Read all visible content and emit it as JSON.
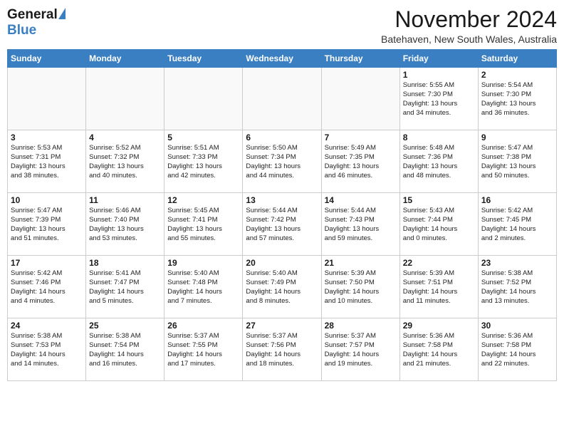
{
  "header": {
    "logo_general": "General",
    "logo_blue": "Blue",
    "month": "November 2024",
    "location": "Batehaven, New South Wales, Australia"
  },
  "weekdays": [
    "Sunday",
    "Monday",
    "Tuesday",
    "Wednesday",
    "Thursday",
    "Friday",
    "Saturday"
  ],
  "weeks": [
    {
      "days": [
        {
          "date": "",
          "info": "",
          "empty": true
        },
        {
          "date": "",
          "info": "",
          "empty": true
        },
        {
          "date": "",
          "info": "",
          "empty": true
        },
        {
          "date": "",
          "info": "",
          "empty": true
        },
        {
          "date": "",
          "info": "",
          "empty": true
        },
        {
          "date": "1",
          "info": "Sunrise: 5:55 AM\nSunset: 7:30 PM\nDaylight: 13 hours\nand 34 minutes."
        },
        {
          "date": "2",
          "info": "Sunrise: 5:54 AM\nSunset: 7:30 PM\nDaylight: 13 hours\nand 36 minutes."
        }
      ]
    },
    {
      "days": [
        {
          "date": "3",
          "info": "Sunrise: 5:53 AM\nSunset: 7:31 PM\nDaylight: 13 hours\nand 38 minutes."
        },
        {
          "date": "4",
          "info": "Sunrise: 5:52 AM\nSunset: 7:32 PM\nDaylight: 13 hours\nand 40 minutes."
        },
        {
          "date": "5",
          "info": "Sunrise: 5:51 AM\nSunset: 7:33 PM\nDaylight: 13 hours\nand 42 minutes."
        },
        {
          "date": "6",
          "info": "Sunrise: 5:50 AM\nSunset: 7:34 PM\nDaylight: 13 hours\nand 44 minutes."
        },
        {
          "date": "7",
          "info": "Sunrise: 5:49 AM\nSunset: 7:35 PM\nDaylight: 13 hours\nand 46 minutes."
        },
        {
          "date": "8",
          "info": "Sunrise: 5:48 AM\nSunset: 7:36 PM\nDaylight: 13 hours\nand 48 minutes."
        },
        {
          "date": "9",
          "info": "Sunrise: 5:47 AM\nSunset: 7:38 PM\nDaylight: 13 hours\nand 50 minutes."
        }
      ]
    },
    {
      "days": [
        {
          "date": "10",
          "info": "Sunrise: 5:47 AM\nSunset: 7:39 PM\nDaylight: 13 hours\nand 51 minutes."
        },
        {
          "date": "11",
          "info": "Sunrise: 5:46 AM\nSunset: 7:40 PM\nDaylight: 13 hours\nand 53 minutes."
        },
        {
          "date": "12",
          "info": "Sunrise: 5:45 AM\nSunset: 7:41 PM\nDaylight: 13 hours\nand 55 minutes."
        },
        {
          "date": "13",
          "info": "Sunrise: 5:44 AM\nSunset: 7:42 PM\nDaylight: 13 hours\nand 57 minutes."
        },
        {
          "date": "14",
          "info": "Sunrise: 5:44 AM\nSunset: 7:43 PM\nDaylight: 13 hours\nand 59 minutes."
        },
        {
          "date": "15",
          "info": "Sunrise: 5:43 AM\nSunset: 7:44 PM\nDaylight: 14 hours\nand 0 minutes."
        },
        {
          "date": "16",
          "info": "Sunrise: 5:42 AM\nSunset: 7:45 PM\nDaylight: 14 hours\nand 2 minutes."
        }
      ]
    },
    {
      "days": [
        {
          "date": "17",
          "info": "Sunrise: 5:42 AM\nSunset: 7:46 PM\nDaylight: 14 hours\nand 4 minutes."
        },
        {
          "date": "18",
          "info": "Sunrise: 5:41 AM\nSunset: 7:47 PM\nDaylight: 14 hours\nand 5 minutes."
        },
        {
          "date": "19",
          "info": "Sunrise: 5:40 AM\nSunset: 7:48 PM\nDaylight: 14 hours\nand 7 minutes."
        },
        {
          "date": "20",
          "info": "Sunrise: 5:40 AM\nSunset: 7:49 PM\nDaylight: 14 hours\nand 8 minutes."
        },
        {
          "date": "21",
          "info": "Sunrise: 5:39 AM\nSunset: 7:50 PM\nDaylight: 14 hours\nand 10 minutes."
        },
        {
          "date": "22",
          "info": "Sunrise: 5:39 AM\nSunset: 7:51 PM\nDaylight: 14 hours\nand 11 minutes."
        },
        {
          "date": "23",
          "info": "Sunrise: 5:38 AM\nSunset: 7:52 PM\nDaylight: 14 hours\nand 13 minutes."
        }
      ]
    },
    {
      "days": [
        {
          "date": "24",
          "info": "Sunrise: 5:38 AM\nSunset: 7:53 PM\nDaylight: 14 hours\nand 14 minutes."
        },
        {
          "date": "25",
          "info": "Sunrise: 5:38 AM\nSunset: 7:54 PM\nDaylight: 14 hours\nand 16 minutes."
        },
        {
          "date": "26",
          "info": "Sunrise: 5:37 AM\nSunset: 7:55 PM\nDaylight: 14 hours\nand 17 minutes."
        },
        {
          "date": "27",
          "info": "Sunrise: 5:37 AM\nSunset: 7:56 PM\nDaylight: 14 hours\nand 18 minutes."
        },
        {
          "date": "28",
          "info": "Sunrise: 5:37 AM\nSunset: 7:57 PM\nDaylight: 14 hours\nand 19 minutes."
        },
        {
          "date": "29",
          "info": "Sunrise: 5:36 AM\nSunset: 7:58 PM\nDaylight: 14 hours\nand 21 minutes."
        },
        {
          "date": "30",
          "info": "Sunrise: 5:36 AM\nSunset: 7:58 PM\nDaylight: 14 hours\nand 22 minutes."
        }
      ]
    }
  ]
}
